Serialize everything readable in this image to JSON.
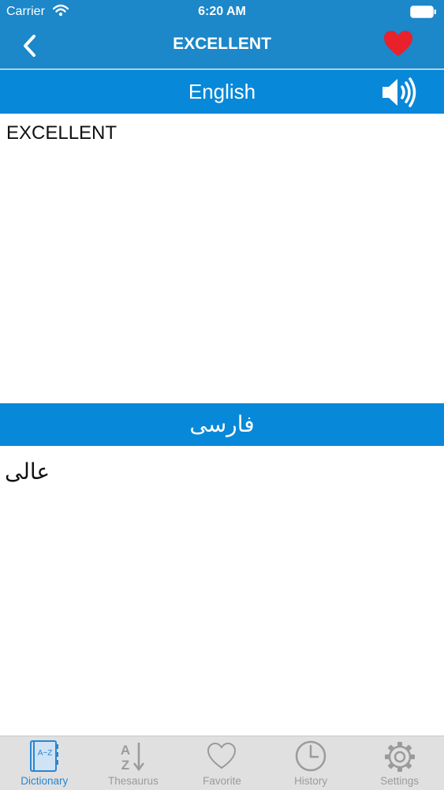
{
  "status": {
    "carrier": "Carrier",
    "time": "6:20 AM"
  },
  "nav": {
    "title": "EXCELLENT",
    "back_icon": "chevron-left-icon",
    "favorite_icon": "heart-icon"
  },
  "colors": {
    "header": "#1c87c9",
    "section_bar": "#0888d8",
    "heart": "#e8212b",
    "tab_active": "#2a86d0",
    "tab_inactive": "#9b9b9b"
  },
  "english": {
    "title": "English",
    "word": "EXCELLENT",
    "speaker_icon": "speaker-icon"
  },
  "farsi": {
    "title": "فارسی",
    "translation": "عالی"
  },
  "tabs": [
    {
      "label": "Dictionary",
      "icon": "dictionary-book-icon",
      "active": true
    },
    {
      "label": "Thesaurus",
      "icon": "az-sort-icon",
      "active": false
    },
    {
      "label": "Favorite",
      "icon": "heart-outline-icon",
      "active": false
    },
    {
      "label": "History",
      "icon": "clock-icon",
      "active": false
    },
    {
      "label": "Settings",
      "icon": "gear-icon",
      "active": false
    }
  ]
}
